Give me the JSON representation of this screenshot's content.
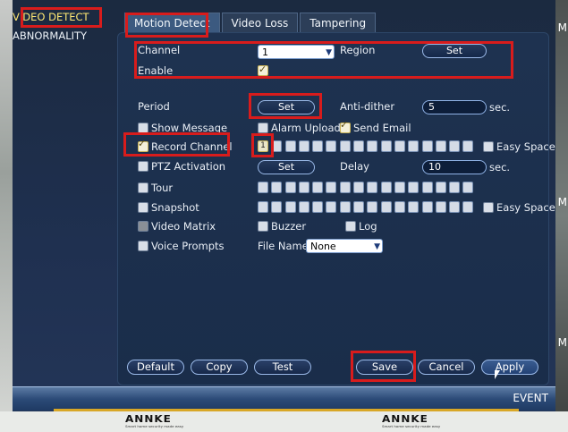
{
  "background": {
    "edge_letter": "M"
  },
  "logos": [
    "ANNKE",
    "ANNKE"
  ],
  "logo_tagline": "Smart home security made easy",
  "menu": [
    {
      "label": "VIDEO DETECT",
      "active": true
    },
    {
      "label": "ABNORMALITY",
      "active": false
    }
  ],
  "tabs": [
    {
      "label": "Motion Detect",
      "active": true
    },
    {
      "label": "Video Loss",
      "active": false
    },
    {
      "label": "Tampering",
      "active": false
    }
  ],
  "form": {
    "channel_label": "Channel",
    "channel_value": "1",
    "region_label": "Region",
    "region_button": "Set",
    "enable_label": "Enable",
    "enable_checked": true,
    "period_label": "Period",
    "period_button": "Set",
    "antidither_label": "Anti-dither",
    "antidither_value": "5",
    "antidither_unit": "sec.",
    "show_message": "Show Message",
    "alarm_upload": "Alarm Upload",
    "send_email": "Send Email",
    "record_channel": "Record Channel",
    "record_selected": "1",
    "easy_space_1": "Easy Space",
    "ptz_activation": "PTZ Activation",
    "ptz_button": "Set",
    "delay_label": "Delay",
    "delay_value": "10",
    "delay_unit": "sec.",
    "tour": "Tour",
    "snapshot": "Snapshot",
    "easy_space_2": "Easy Space",
    "video_matrix": "Video Matrix",
    "buzzer": "Buzzer",
    "log": "Log",
    "voice_prompts": "Voice Prompts",
    "file_name_label": "File Name",
    "file_name_value": "None"
  },
  "buttons": {
    "default": "Default",
    "copy": "Copy",
    "test": "Test",
    "save": "Save",
    "cancel": "Cancel",
    "apply": "Apply"
  },
  "status": {
    "event": "EVENT"
  },
  "colors": {
    "annotation": "#d81c1c",
    "active_menu": "#ffe873"
  }
}
